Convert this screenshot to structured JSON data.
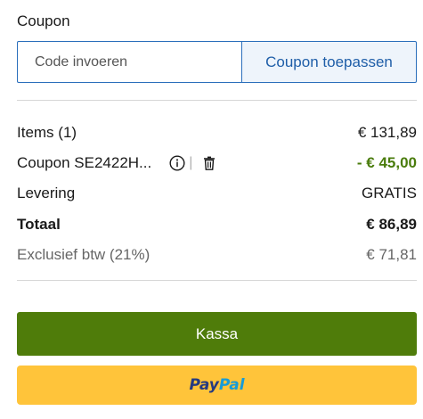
{
  "coupon": {
    "label": "Coupon",
    "input_value": "",
    "input_placeholder": "Code invoeren",
    "apply_label": "Coupon toepassen"
  },
  "summary": {
    "items_label": "Items (1)",
    "items_value": "€ 131,89",
    "coupon_label": "Coupon SE2422H...",
    "coupon_info_icon": "info-icon",
    "coupon_separator": "|",
    "coupon_remove_icon": "trash-icon",
    "coupon_value": "- € 45,00",
    "delivery_label": "Levering",
    "delivery_value": "GRATIS",
    "total_label": "Totaal",
    "total_value": "€ 86,89",
    "excl_vat_label": "Exclusief btw (21%)",
    "excl_vat_value": "€ 71,81"
  },
  "actions": {
    "checkout_label": "Kassa",
    "paypal_part1": "Pay",
    "paypal_part2": "Pal"
  },
  "colors": {
    "accent_blue": "#2a6ebb",
    "discount_green": "#4a7c0c",
    "checkout_green": "#4f7c0a",
    "paypal_yellow": "#ffc43a",
    "paypal_dark_blue": "#253b80",
    "paypal_light_blue": "#179bd7"
  }
}
